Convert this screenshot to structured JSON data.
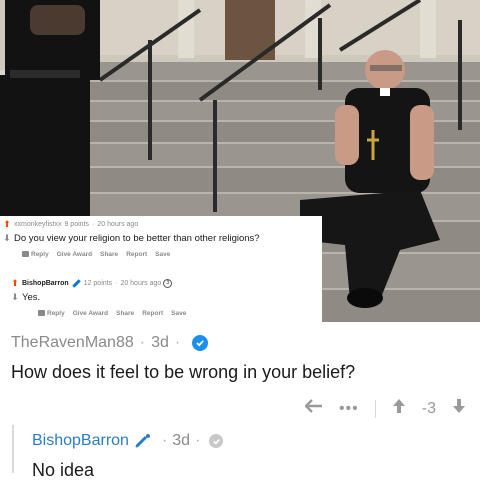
{
  "screenshot_comment": {
    "username": "xxmonkeyfistxx",
    "points": "9 points",
    "time": "20 hours ago",
    "body": "Do you view your religion to be better than other religions?",
    "actions": [
      "Reply",
      "Give Award",
      "Share",
      "Report",
      "Save"
    ]
  },
  "screenshot_reply": {
    "username": "BishopBarron",
    "points": "12 points",
    "time": "20 hours ago",
    "body": "Yes.",
    "actions": [
      "Reply",
      "Give Award",
      "Share",
      "Report",
      "Save"
    ]
  },
  "comment": {
    "username": "TheRavenMan88",
    "age": "3d",
    "body": "How does it feel to be wrong in your belief?",
    "score": "-3",
    "more": "•••"
  },
  "reply": {
    "username": "BishopBarron",
    "age": "3d",
    "body": "No idea"
  },
  "colors": {
    "reddit_orange": "#ff4500",
    "link_blue": "#2a7cc7",
    "verified_blue": "#1a8ff0",
    "meta_gray": "#8a8a8a"
  },
  "icons": [
    "upvote-icon",
    "downvote-icon",
    "verified-check-icon",
    "mod-pencil-icon",
    "back-arrow-icon",
    "more-dots-icon"
  ]
}
